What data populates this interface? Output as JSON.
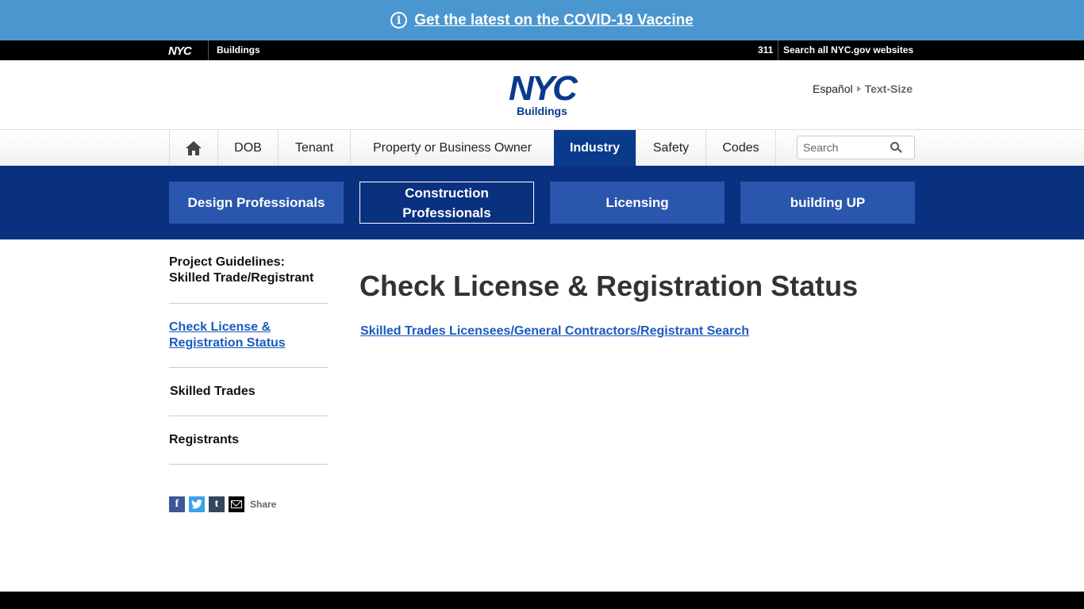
{
  "alert": {
    "icon": "info-icon",
    "text": "Get the latest on the COVID-19 Vaccine",
    "color": "#4a96cf"
  },
  "topbar": {
    "logo": "NYC",
    "agency": "Buildings",
    "t311": "311",
    "search_all": "Search all NYC.gov websites"
  },
  "header": {
    "logo_main": "NYC",
    "logo_sub": "Buildings",
    "language": "Español",
    "text_size": "Text-Size"
  },
  "nav": {
    "home_icon": "home-icon",
    "items": [
      "DOB",
      "Tenant",
      "Property or Business Owner",
      "Industry",
      "Safety",
      "Codes"
    ],
    "active": "Industry",
    "search_placeholder": "Search"
  },
  "subnav": {
    "items": [
      "Design Professionals",
      "Construction Professionals",
      "Licensing",
      "building UP"
    ],
    "active": "Construction Professionals"
  },
  "sidebar": {
    "heading": "Project Guidelines: Skilled Trade/Registrant",
    "current": "Check License & Registration Status",
    "items": [
      "Skilled Trades",
      "Registrants"
    ]
  },
  "share": {
    "icons": [
      "facebook-icon",
      "twitter-icon",
      "tumblr-icon",
      "email-icon"
    ],
    "label": "Share"
  },
  "main": {
    "title": "Check License & Registration Status",
    "link": "Skilled Trades Licensees/General Contractors/Registrant Search"
  },
  "colors": {
    "navy": "#0a3a8c",
    "subnav_btn": "#2a56ad",
    "link": "#1a5bbf"
  }
}
